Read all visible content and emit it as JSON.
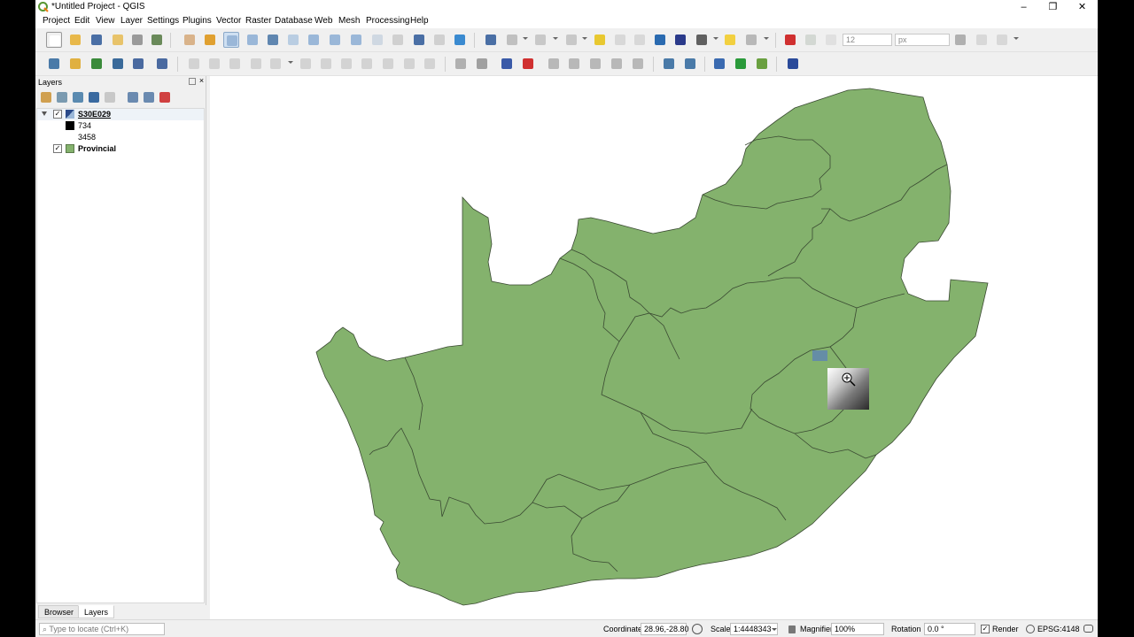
{
  "window": {
    "title": "*Untitled Project - QGIS",
    "controls": [
      "–",
      "❐",
      "✕"
    ]
  },
  "menu": [
    "Project",
    "Edit",
    "View",
    "Layer",
    "Settings",
    "Plugins",
    "Vector",
    "Raster",
    "Database",
    "Web",
    "Mesh",
    "Processing",
    "Help"
  ],
  "toolbar": {
    "size_value": "12",
    "unit_value": "px"
  },
  "layers_panel": {
    "title": "Layers",
    "layers": [
      {
        "name": "S30E029",
        "checked": true,
        "expanded": true,
        "type": "raster"
      },
      {
        "legend": "734",
        "color": "#000000"
      },
      {
        "legend": "3458",
        "color": "#ffffff"
      },
      {
        "name": "Provincial",
        "checked": true,
        "type": "vector",
        "color": "#84b26d"
      }
    ]
  },
  "panel_tabs": [
    "Browser",
    "Layers"
  ],
  "status": {
    "locator_placeholder": "Type to locate (Ctrl+K)",
    "coordinate_label": "Coordinate",
    "coordinate_value": "28.96,-28.80",
    "scale_label": "Scale",
    "scale_value": "1:4448343",
    "magnifier_label": "Magnifier",
    "magnifier_value": "100%",
    "rotation_label": "Rotation",
    "rotation_value": "0.0 °",
    "render_label": "Render",
    "crs_label": "EPSG:4148"
  },
  "map": {
    "fill_color": "#84b26d",
    "stroke_color": "#3a4a32",
    "highlight_color": "#5f86b0"
  }
}
